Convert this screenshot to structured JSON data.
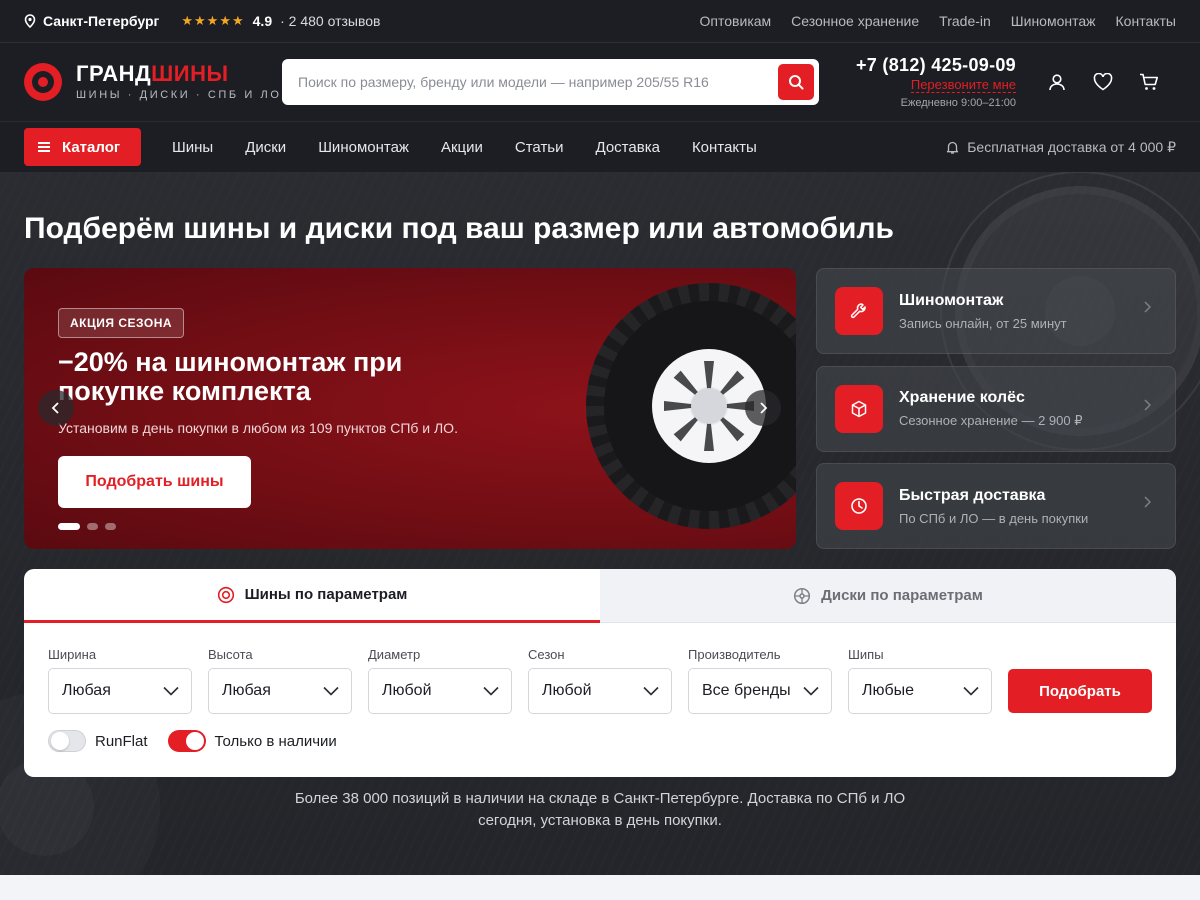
{
  "topbar": {
    "city": "Санкт-Петербург",
    "stars": "★★★★★",
    "score": "4.9",
    "reviews": "· 2 480 отзывов",
    "links": [
      "Оптовикам",
      "Сезонное хранение",
      "Trade-in",
      "Шиномонтаж",
      "Контакты"
    ]
  },
  "header": {
    "logo_part1": "ГРАНД",
    "logo_part2": "ШИНЫ",
    "logo_sub": "ШИНЫ · ДИСКИ · СПБ И ЛО",
    "search_placeholder": "Поиск по размеру, бренду или модели — например 205/55 R16",
    "phone": "+7 (812) 425-09-09",
    "callback": "Перезвоните мне",
    "hours": "Ежедневно 9:00–21:00"
  },
  "nav": {
    "catalog": "Каталог",
    "links": [
      "Шины",
      "Диски",
      "Шиномонтаж",
      "Акции",
      "Статьи",
      "Доставка",
      "Контакты"
    ],
    "delivery_note": "Бесплатная доставка от 4 000 ₽"
  },
  "hero": {
    "title": "Подберём шины и диски под ваш размер или автомобиль",
    "banner": {
      "badge": "АКЦИЯ СЕЗОНА",
      "title": "−20% на шиномонтаж при покупке комплекта",
      "subtitle": "Установим в день покупки в любом из 109 пунктов СПб и ЛО.",
      "button": "Подобрать шины"
    },
    "services": [
      {
        "title": "Шиномонтаж",
        "subtitle": "Запись онлайн, от 25 минут"
      },
      {
        "title": "Хранение колёс",
        "subtitle": "Сезонное хранение — 2 900 ₽"
      },
      {
        "title": "Быстрая доставка",
        "subtitle": "По СПб и ЛО — в день покупки"
      }
    ],
    "note": "Более 38 000 позиций в наличии на складе в Санкт-Петербурге. Доставка по СПб и ЛО сегодня, установка в день покупки."
  },
  "filter": {
    "tab_tires": "Шины по параметрам",
    "tab_rims": "Диски по параметрам",
    "fields": [
      {
        "label": "Ширина",
        "value": "Любая"
      },
      {
        "label": "Высота",
        "value": "Любая"
      },
      {
        "label": "Диаметр",
        "value": "Любой"
      },
      {
        "label": "Сезон",
        "value": "Любой"
      },
      {
        "label": "Производитель",
        "value": "Все бренды"
      },
      {
        "label": "Шипы",
        "value": "Любые"
      }
    ],
    "submit": "Подобрать",
    "toggle_runflat": "RunFlat",
    "toggle_in_stock": "Только в наличии"
  },
  "colors": {
    "accent": "#e31e24",
    "dark": "#1c1e23",
    "banner": "#7a0f16"
  }
}
